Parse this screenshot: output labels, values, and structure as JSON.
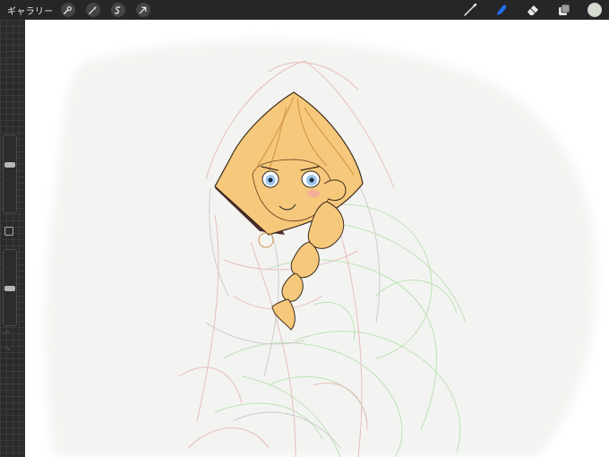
{
  "topbar": {
    "gallery_label": "ギャラリー",
    "left_tools": [
      "wrench-icon",
      "magic-wand-icon",
      "selection-icon",
      "transform-arrow-icon"
    ],
    "right_tools": [
      "brush-icon",
      "smudge-icon",
      "eraser-icon",
      "layers-icon"
    ],
    "active_tool": "smudge-icon",
    "active_color": "#d6dbd1",
    "accent_color": "#1e6ff0"
  },
  "sidebar": {
    "brush_size_level": 0.38,
    "opacity_level": 0.55
  },
  "artwork": {
    "hair_color": "#f6c87b",
    "hood_color": "#4a2c2a",
    "eye_color": "#9dc5ec",
    "sketch_red": "#e5b8b8",
    "sketch_green": "#b7dfae"
  }
}
